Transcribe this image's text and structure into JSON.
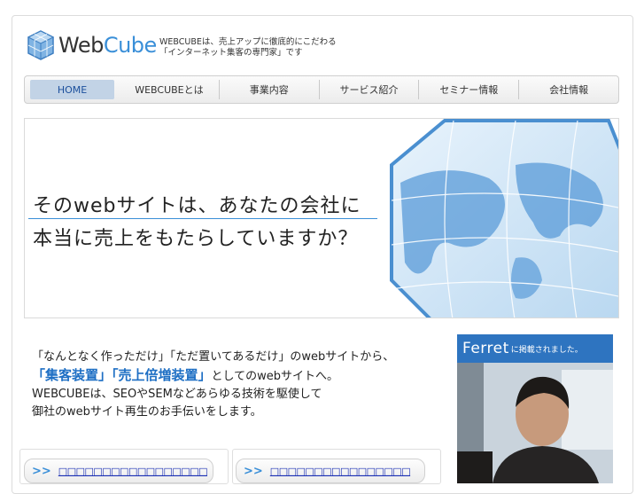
{
  "header": {
    "logo_web": "Web",
    "logo_cube": "Cube",
    "tagline_line1": "WEBCUBEは、売上アップに徹底的にこだわる",
    "tagline_line2": "「インターネット集客の専門家」です"
  },
  "nav": {
    "items": [
      {
        "label": "HOME"
      },
      {
        "label": "WEBCUBEとは"
      },
      {
        "label": "事業内容"
      },
      {
        "label": "サービス紹介"
      },
      {
        "label": "セミナー情報"
      },
      {
        "label": "会社情報"
      }
    ]
  },
  "hero": {
    "line1": "そのwebサイトは、あなたの会社に",
    "line2": "本当に売上をもたらしていますか？"
  },
  "intro": {
    "line1": "「なんとなく作っただけ」「ただ置いてあるだけ」のwebサイトから、",
    "highlight": "「集客装置」「売上倍増装置」",
    "line2_rest": "としてのwebサイトへ。",
    "line3": "WEBCUBEは、SEOやSEMなどあらゆる技術を駆使して",
    "line4": "御社のwebサイト再生のお手伝いをします。"
  },
  "ferret": {
    "brand": "Ferret",
    "caption": "に掲載されました。"
  },
  "links": [
    {
      "arrow": ">>",
      "text": "□□□□□□□□□□□□□□□□□"
    },
    {
      "arrow": ">>",
      "text": "□□□□□□□□□□□□□□□□"
    }
  ],
  "colors": {
    "accent": "#3a8fd8",
    "nav_active": "#c2d3e6",
    "link": "#1a2fb4",
    "ferret_bar": "#2e74c0"
  }
}
